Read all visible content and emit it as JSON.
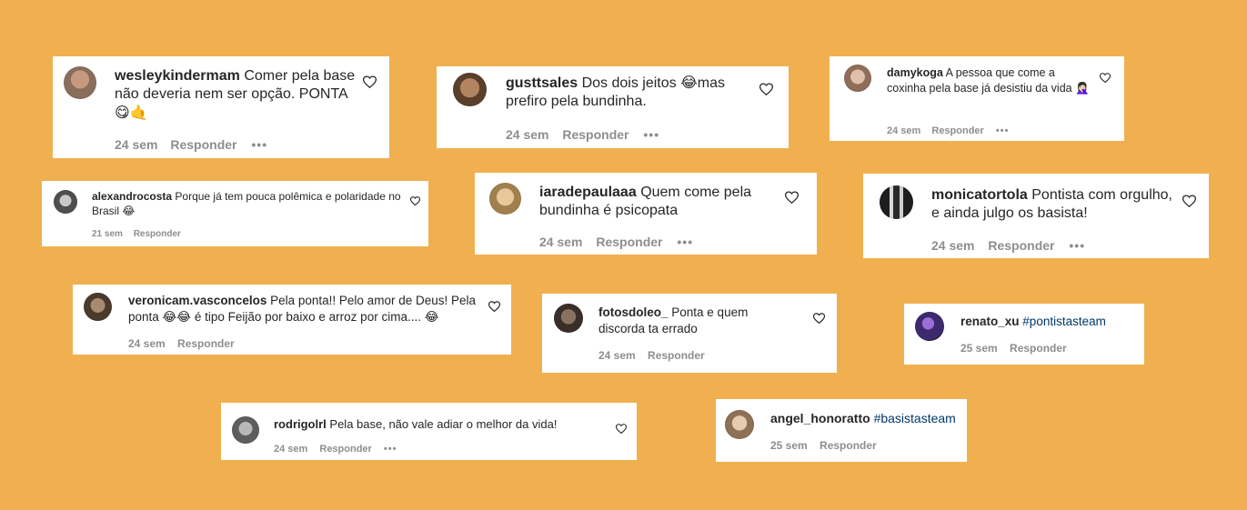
{
  "comments": [
    {
      "username": "wesleykindermam",
      "text": "Comer pela base não deveria nem ser opção. PONTA😋🤙",
      "time": "24 sem",
      "reply": "Responder",
      "more": "•••",
      "avatar_color": "#8a6e5c"
    },
    {
      "username": "gusttsales",
      "text": "Dos dois jeitos 😂mas prefiro pela bundinha.",
      "time": "24 sem",
      "reply": "Responder",
      "more": "•••",
      "avatar_color": "#7b5a3c"
    },
    {
      "username": "damykoga",
      "text": "A pessoa que come a coxinha pela base já desistiu da vida 🤦🏻‍♀️",
      "time": "24 sem",
      "reply": "Responder",
      "more": "•••",
      "avatar_color": "#b68f7a"
    },
    {
      "username": "alexandrocosta",
      "text": "Porque já tem pouca polêmica e polaridade no Brasil 😂",
      "time": "21 sem",
      "reply": "Responder",
      "avatar_color": "#6e6e6e"
    },
    {
      "username": "iaradepaulaaa",
      "text": "Quem come pela bundinha é psicopata",
      "time": "24 sem",
      "reply": "Responder",
      "more": "•••",
      "avatar_color": "#c9a878"
    },
    {
      "username": "monicatortola",
      "text": "Pontista com orgulho, e ainda julgo os basista!",
      "time": "24 sem",
      "reply": "Responder",
      "more": "•••",
      "avatar_color": "#2f2f2f"
    },
    {
      "username": "veronicam.vasconcelos",
      "text": "Pela ponta!! Pelo amor de Deus! Pela ponta 😂😂 é tipo Feijão por baixo e arroz por cima.... 😂",
      "time": "24 sem",
      "reply": "Responder",
      "avatar_color": "#5e4a3a"
    },
    {
      "username": "fotosdoleo_",
      "text": "Ponta e quem discorda ta errado",
      "time": "24 sem",
      "reply": "Responder",
      "avatar_color": "#4a3b33"
    },
    {
      "username": "renato_xu",
      "tag": "#pontistasteam",
      "time": "25 sem",
      "reply": "Responder",
      "avatar_color": "#3d2a6e"
    },
    {
      "username": "rodrigolrl",
      "text": "Pela base, não vale adiar o melhor da vida!",
      "time": "24 sem",
      "reply": "Responder",
      "more": "•••",
      "avatar_color": "#7a7a7a"
    },
    {
      "username": "angel_honoratto",
      "tag": "#basistasteam",
      "time": "25 sem",
      "reply": "Responder",
      "avatar_color": "#b89a80"
    }
  ]
}
